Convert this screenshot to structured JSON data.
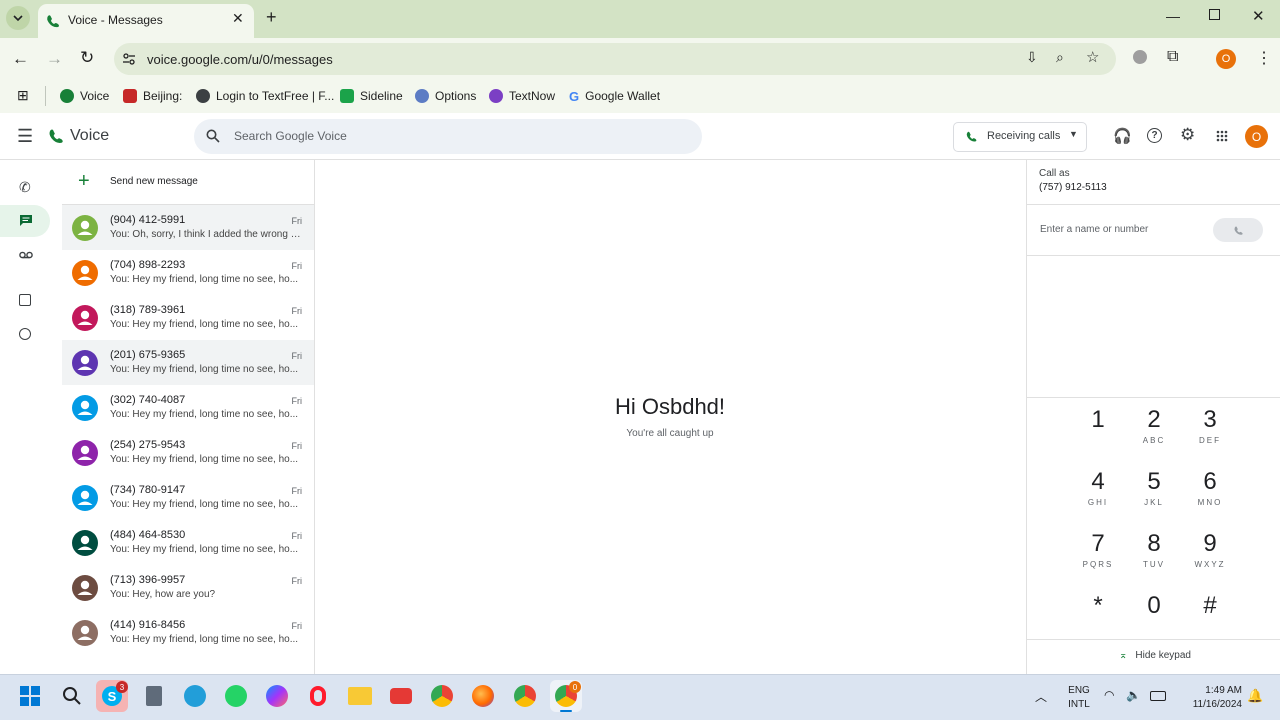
{
  "browser": {
    "tab_title": "Voice - Messages",
    "url": "voice.google.com/u/0/messages",
    "profile_initial": "O",
    "bookmarks": [
      "Voice",
      "Beijing:",
      "Login to TextFree | F...",
      "Sideline",
      "Options",
      "TextNow",
      "Google Wallet"
    ]
  },
  "app": {
    "name": "Voice",
    "search_placeholder": "Search Google Voice",
    "receiving_label": "Receiving calls",
    "avatar_initial": "O"
  },
  "sidebar": {
    "send_new_message": "Send new message"
  },
  "conversations": [
    {
      "number": "(904) 412-5991",
      "preview": "You: Oh, sorry, I think I added the wrong n...",
      "day": "Fri",
      "color": "#7cb342"
    },
    {
      "number": "(704) 898-2293",
      "preview": "You: Hey my friend, long time no see, ho...",
      "day": "Fri",
      "color": "#ef6c00"
    },
    {
      "number": "(318) 789-3961",
      "preview": "You: Hey my friend, long time no see, ho...",
      "day": "Fri",
      "color": "#c2185b"
    },
    {
      "number": "(201) 675-9365",
      "preview": "You: Hey my friend, long time no see, ho...",
      "day": "Fri",
      "color": "#5e35b1"
    },
    {
      "number": "(302) 740-4087",
      "preview": "You: Hey my friend, long time no see, ho...",
      "day": "Fri",
      "color": "#039be5"
    },
    {
      "number": "(254) 275-9543",
      "preview": "You: Hey my friend, long time no see, ho...",
      "day": "Fri",
      "color": "#8e24aa"
    },
    {
      "number": "(734) 780-9147",
      "preview": "You: Hey my friend, long time no see, ho...",
      "day": "Fri",
      "color": "#039be5"
    },
    {
      "number": "(484) 464-8530",
      "preview": "You: Hey my friend, long time no see, ho...",
      "day": "Fri",
      "color": "#004d40"
    },
    {
      "number": "(713) 396-9957",
      "preview": "You: Hey, how are you?",
      "day": "Fri",
      "color": "#6d4c41"
    },
    {
      "number": "(414) 916-8456",
      "preview": "You: Hey my friend, long time no see, ho...",
      "day": "Fri",
      "color": "#8d6e63"
    }
  ],
  "main": {
    "greeting": "Hi Osbdhd!",
    "subtitle": "You're all caught up"
  },
  "dialer": {
    "call_as_label": "Call as",
    "call_as_number": "(757) 912-5113",
    "input_placeholder": "Enter a name or number",
    "keys": [
      {
        "d": "1",
        "l": ""
      },
      {
        "d": "2",
        "l": "ABC"
      },
      {
        "d": "3",
        "l": "DEF"
      },
      {
        "d": "4",
        "l": "GHI"
      },
      {
        "d": "5",
        "l": "JKL"
      },
      {
        "d": "6",
        "l": "MNO"
      },
      {
        "d": "7",
        "l": "PQRS"
      },
      {
        "d": "8",
        "l": "TUV"
      },
      {
        "d": "9",
        "l": "WXYZ"
      },
      {
        "d": "*",
        "l": ""
      },
      {
        "d": "0",
        "l": ""
      },
      {
        "d": "#",
        "l": ""
      }
    ],
    "hide_keypad": "Hide keypad"
  },
  "taskbar": {
    "lang_top": "ENG",
    "lang_bottom": "INTL",
    "time": "1:49 AM",
    "date": "11/16/2024",
    "badge_skype": "3",
    "badge_chrome": "0"
  }
}
